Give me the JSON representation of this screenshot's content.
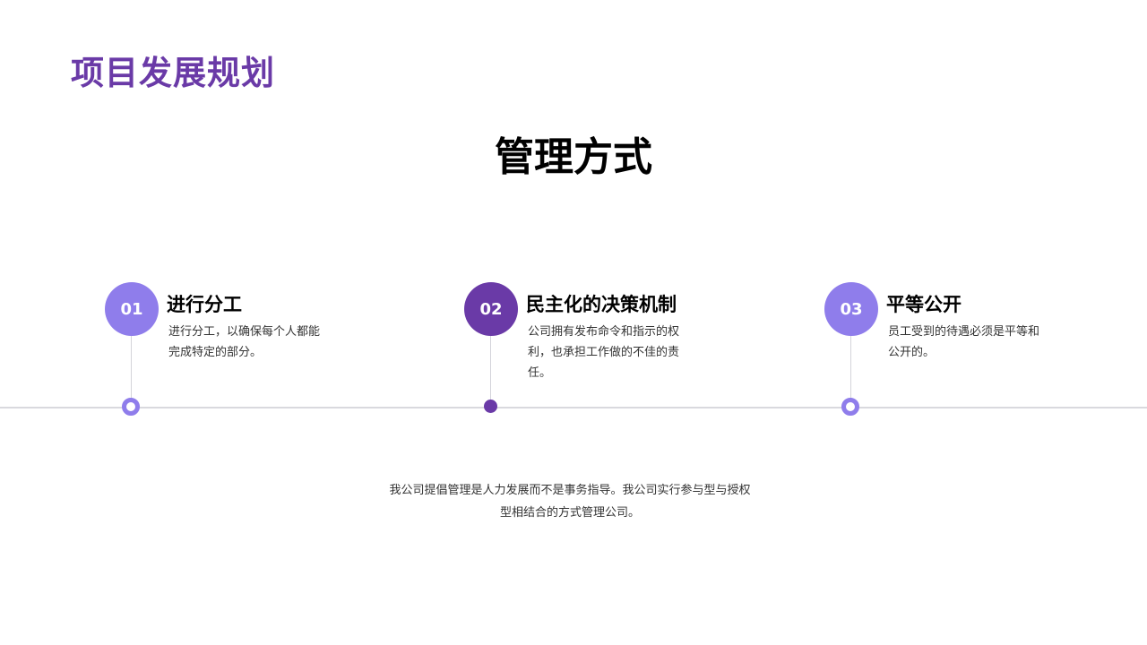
{
  "colors": {
    "title_purple": "#6a3aa7",
    "circle_light": "#8f7deb",
    "circle_dark": "#6a3aa7",
    "line_gray": "#d9d9de"
  },
  "page_title": "项目发展规划",
  "main_heading": "管理方式",
  "steps": [
    {
      "number": "01",
      "title": "进行分工",
      "desc": "进行分工，以确保每个人都能完成特定的部分。"
    },
    {
      "number": "02",
      "title": "民主化的决策机制",
      "desc": "公司拥有发布命令和指示的权利，也承担工作做的不佳的责任。"
    },
    {
      "number": "03",
      "title": "平等公开",
      "desc": "员工受到的待遇必须是平等和公开的。"
    }
  ],
  "footer": "我公司提倡管理是人力发展而不是事务指导。我公司实行参与型与授权型相结合的方式管理公司。"
}
